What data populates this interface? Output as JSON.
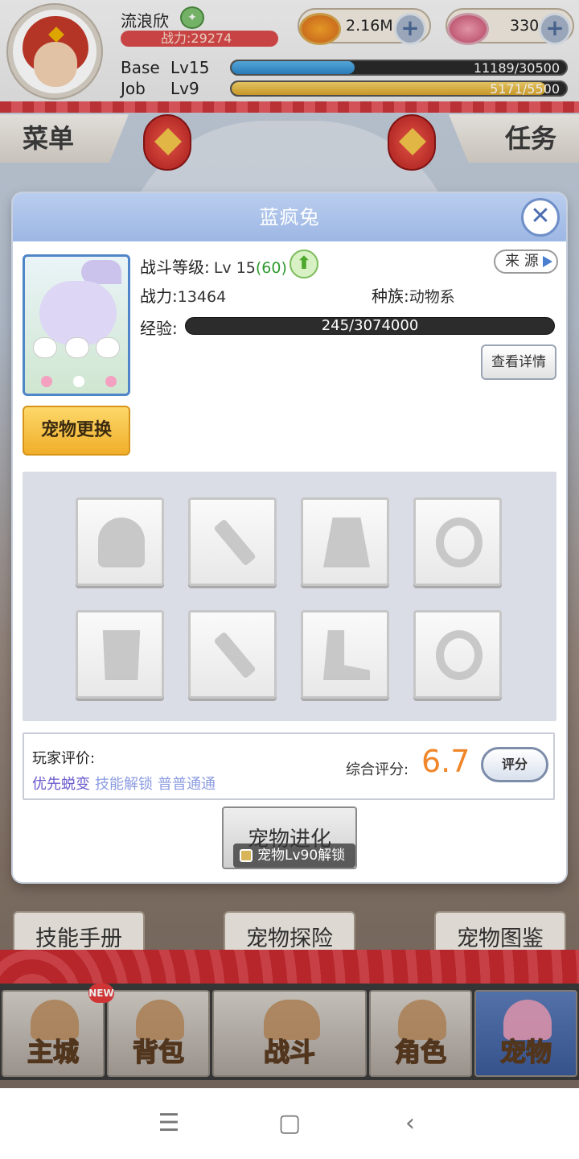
{
  "player": {
    "name": "流浪欣",
    "power": "战力:29274",
    "base_label": "Base",
    "base_level": "Lv15",
    "base_exp": "11189/30500",
    "base_fill": 0.3669,
    "job_label": "Job",
    "job_level": "Lv9",
    "job_exp": "5171/5500",
    "job_fill": 0.9402
  },
  "resources": {
    "gold": "2.16M",
    "gems": "330"
  },
  "side_tabs": {
    "menu": "菜单",
    "task": "任务"
  },
  "modal": {
    "title": "蓝疯兔",
    "battle_level_label": "战斗等级:",
    "battle_level_value": "Lv 15",
    "battle_level_max": "(60)",
    "source_label": "来 源",
    "power_label": "战力:",
    "power_value": "13464",
    "race_label": "种族:",
    "race_value": "动物系",
    "exp_label": "经验:",
    "exp_value": "245/3074000",
    "detail_button": "查看详情",
    "swap_button": "宠物更换",
    "review_title": "玩家评价:",
    "review_tags": [
      "优先蜕变",
      "技能解锁",
      "普普通通"
    ],
    "score_label": "综合评分:",
    "score_value": "6.7",
    "rate_button": "评分",
    "evolve_button": "宠物进化",
    "evolve_lock": "宠物Lv90解锁",
    "equipment_slots": [
      "helmet-icon",
      "sword-icon",
      "cape-icon",
      "ring-icon",
      "armor-icon",
      "sword-icon",
      "boots-icon",
      "ring-icon"
    ]
  },
  "sub_buttons": {
    "skill_book": "技能手册",
    "pet_explore": "宠物探险",
    "pet_atlas": "宠物图鉴"
  },
  "nav": {
    "main_city": "主城",
    "bag": "背包",
    "battle": "战斗",
    "character": "角色",
    "pet": "宠物",
    "new_badge": "NEW"
  },
  "colors": {
    "modal_header": "#9db7e4",
    "score": "#f0862a",
    "review_tag_1": "#6a5acd",
    "review_tag_2": "#8b9be0",
    "level_max": "#2e9a2e"
  }
}
